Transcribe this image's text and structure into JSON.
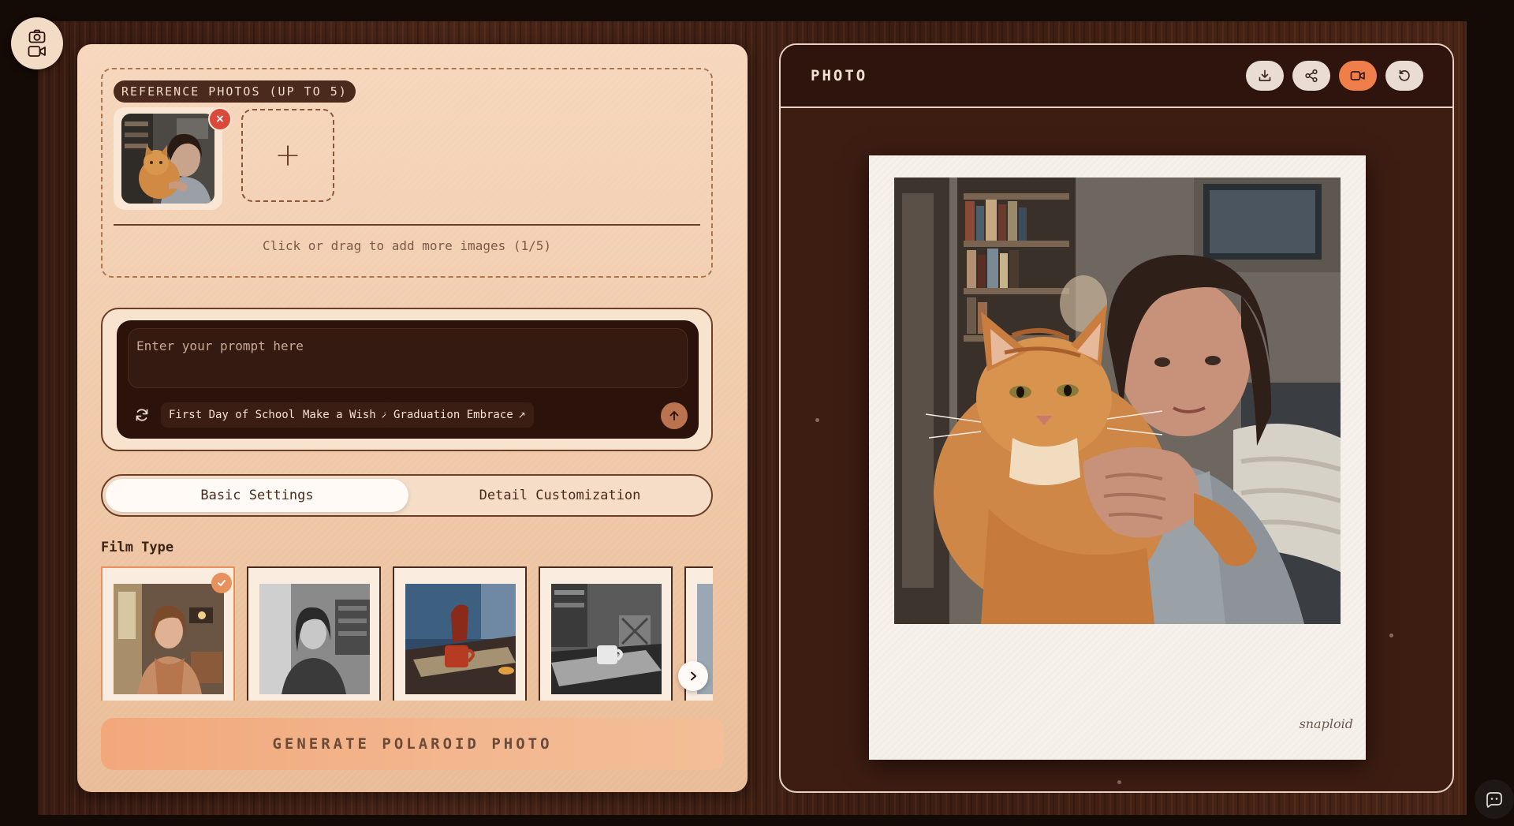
{
  "mode_badge": {
    "icons": [
      "camera-icon",
      "video-icon"
    ]
  },
  "upload": {
    "tag": "REFERENCE PHOTOS (UP TO 5)",
    "remove_label": "×",
    "add_label": "+",
    "hint": "Click or drag to add more images (1/5)"
  },
  "prompt": {
    "placeholder": "Enter your prompt here",
    "suggestions": [
      {
        "label": "First Day of School",
        "arrow": "↗"
      },
      {
        "label": "Make a Wish",
        "arrow": "↗"
      },
      {
        "label": "Graduation Embrace",
        "arrow": "↗"
      }
    ]
  },
  "tabs": [
    {
      "label": "Basic Settings",
      "active": true
    },
    {
      "label": "Detail Customization",
      "active": false
    }
  ],
  "film": {
    "label": "Film Type",
    "selected_index": 0,
    "items": [
      "color-portrait",
      "bw-portrait",
      "color-still-life",
      "bw-still-life"
    ]
  },
  "generate_label": "GENERATE POLAROID PHOTO",
  "preview": {
    "title": "PHOTO",
    "actions": [
      "download-icon",
      "share-icon",
      "video-icon",
      "refresh-icon"
    ],
    "brand": "snaploid"
  },
  "colors": {
    "accent": "#ef7e4a",
    "panel": "#f6d7bd",
    "dark": "#2b130c"
  }
}
